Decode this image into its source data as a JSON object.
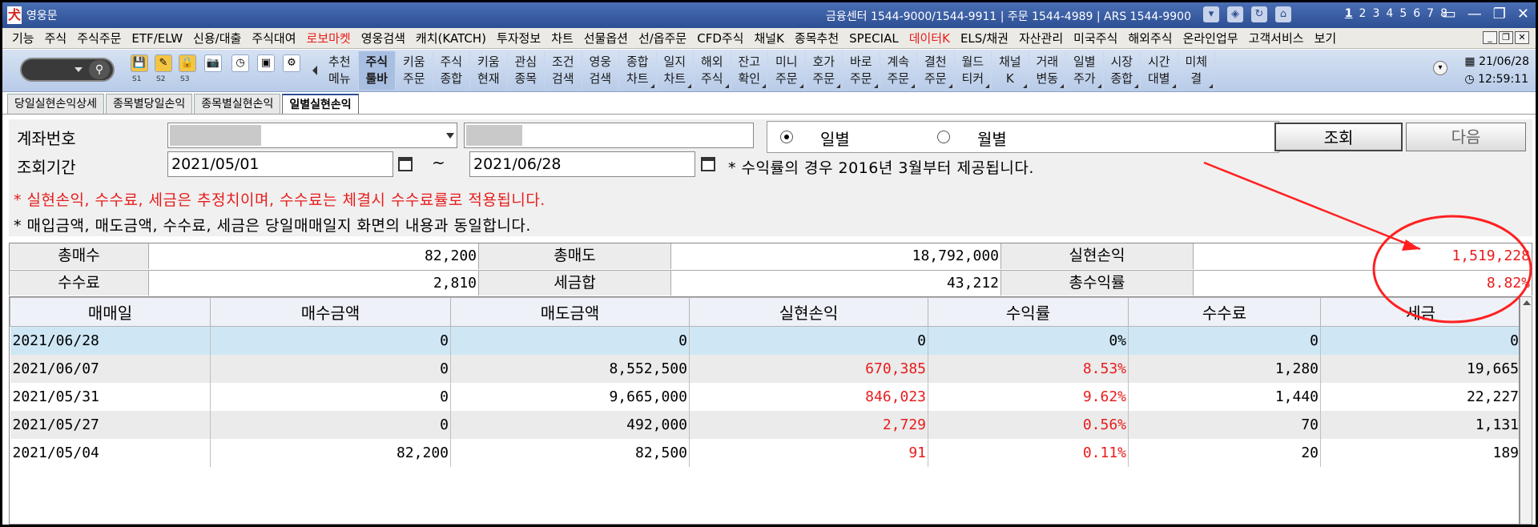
{
  "titlebar": {
    "app_title": "영웅문",
    "info": "금융센터 1544-9000/1544-9911 | 주문 1544-4989 | ARS 1544-9900",
    "window_numbers": [
      "1",
      "2",
      "3",
      "4",
      "5",
      "6",
      "7",
      "8"
    ]
  },
  "menu": [
    "기능",
    "주식",
    "주식주문",
    "ETF/ELW",
    "신용/대출",
    "주식대여",
    "로보마켓",
    "영웅검색",
    "캐치(KATCH)",
    "투자정보",
    "차트",
    "선물옵션",
    "선/옵주문",
    "CFD주식",
    "채널K",
    "종목추천",
    "SPECIAL",
    "데이터K",
    "ELS/채권",
    "자산관리",
    "미국주식",
    "해외주식",
    "온라인업무",
    "고객서비스",
    "보기"
  ],
  "menu_red": [
    "로보마켓",
    "데이터K"
  ],
  "toolbar": {
    "small_labels": [
      "S1",
      "S2",
      "S3"
    ],
    "buttons": [
      {
        "l1": "추천",
        "l2": "메뉴",
        "sel": false
      },
      {
        "l1": "주식",
        "l2": "툴바",
        "sel": true
      },
      {
        "l1": "키움",
        "l2": "주문",
        "sel": false
      },
      {
        "l1": "주식",
        "l2": "종합",
        "sel": false
      },
      {
        "l1": "키움",
        "l2": "현재",
        "sel": false
      },
      {
        "l1": "관심",
        "l2": "종목",
        "sel": false
      },
      {
        "l1": "조건",
        "l2": "검색",
        "sel": false
      },
      {
        "l1": "영웅",
        "l2": "검색",
        "sel": false
      },
      {
        "l1": "종합",
        "l2": "차트",
        "sel": false
      },
      {
        "l1": "일지",
        "l2": "차트",
        "sel": false
      },
      {
        "l1": "해외",
        "l2": "주식",
        "sel": false
      },
      {
        "l1": "잔고",
        "l2": "확인",
        "sel": false
      },
      {
        "l1": "미니",
        "l2": "주문",
        "sel": false
      },
      {
        "l1": "호가",
        "l2": "주문",
        "sel": false
      },
      {
        "l1": "바로",
        "l2": "주문",
        "sel": false
      },
      {
        "l1": "계속",
        "l2": "주문",
        "sel": false
      },
      {
        "l1": "결천",
        "l2": "주문",
        "sel": false
      },
      {
        "l1": "월드",
        "l2": "티커",
        "sel": false
      },
      {
        "l1": "채널",
        "l2": "K",
        "sel": false
      },
      {
        "l1": "거래",
        "l2": "변동",
        "sel": false
      },
      {
        "l1": "일별",
        "l2": "주가",
        "sel": false
      },
      {
        "l1": "시장",
        "l2": "종합",
        "sel": false
      },
      {
        "l1": "시간",
        "l2": "대별",
        "sel": false
      },
      {
        "l1": "미체",
        "l2": "결",
        "sel": false
      }
    ],
    "date": "21/06/28",
    "time": "12:59:11"
  },
  "tabs": [
    {
      "label": "당일실현손익상세",
      "active": false
    },
    {
      "label": "종목별당일손익",
      "active": false
    },
    {
      "label": "종목별실현손익",
      "active": false
    },
    {
      "label": "일별실현손익",
      "active": true
    }
  ],
  "form": {
    "account_label": "계좌번호",
    "period_label": "조회기간",
    "start_date": "2021/05/01",
    "end_date": "2021/06/28",
    "tilde": "~",
    "radio_daily": "일별",
    "radio_monthly": "월별",
    "query_button": "조회",
    "next_button": "다음",
    "note_yield": "* 수익률의 경우 2016년 3월부터 제공됩니다.",
    "note_red": "* 실현손익, 수수료, 세금은 추정치이며, 수수료는 체결시 수수료률로 적용됩니다.",
    "note_black": "* 매입금액, 매도금액, 수수료, 세금은 당일매매일지 화면의 내용과 동일합니다."
  },
  "summary": {
    "total_buy_label": "총매수",
    "total_buy": "82,200",
    "total_sell_label": "총매도",
    "total_sell": "18,792,000",
    "realized_label": "실현손익",
    "realized": "1,519,228",
    "fee_label": "수수료",
    "fee": "2,810",
    "tax_label": "세금합",
    "tax": "43,212",
    "total_yield_label": "총수익률",
    "total_yield": "8.82%"
  },
  "table": {
    "headers": [
      "매매일",
      "매수금액",
      "매도금액",
      "실현손익",
      "수익률",
      "수수료",
      "세금"
    ],
    "rows": [
      [
        "2021/06/28",
        "0",
        "0",
        "0",
        "0%",
        "0",
        "0"
      ],
      [
        "2021/06/07",
        "0",
        "8,552,500",
        "670,385",
        "8.53%",
        "1,280",
        "19,665"
      ],
      [
        "2021/05/31",
        "0",
        "9,665,000",
        "846,023",
        "9.62%",
        "1,440",
        "22,227"
      ],
      [
        "2021/05/27",
        "0",
        "492,000",
        "2,729",
        "0.56%",
        "70",
        "1,131"
      ],
      [
        "2021/05/04",
        "82,200",
        "82,500",
        "91",
        "0.11%",
        "20",
        "189"
      ]
    ]
  },
  "colors": {
    "accent_red": "#e81c1c",
    "title_blue": "#2d4f93",
    "selected_row": "#cfe7f5"
  }
}
